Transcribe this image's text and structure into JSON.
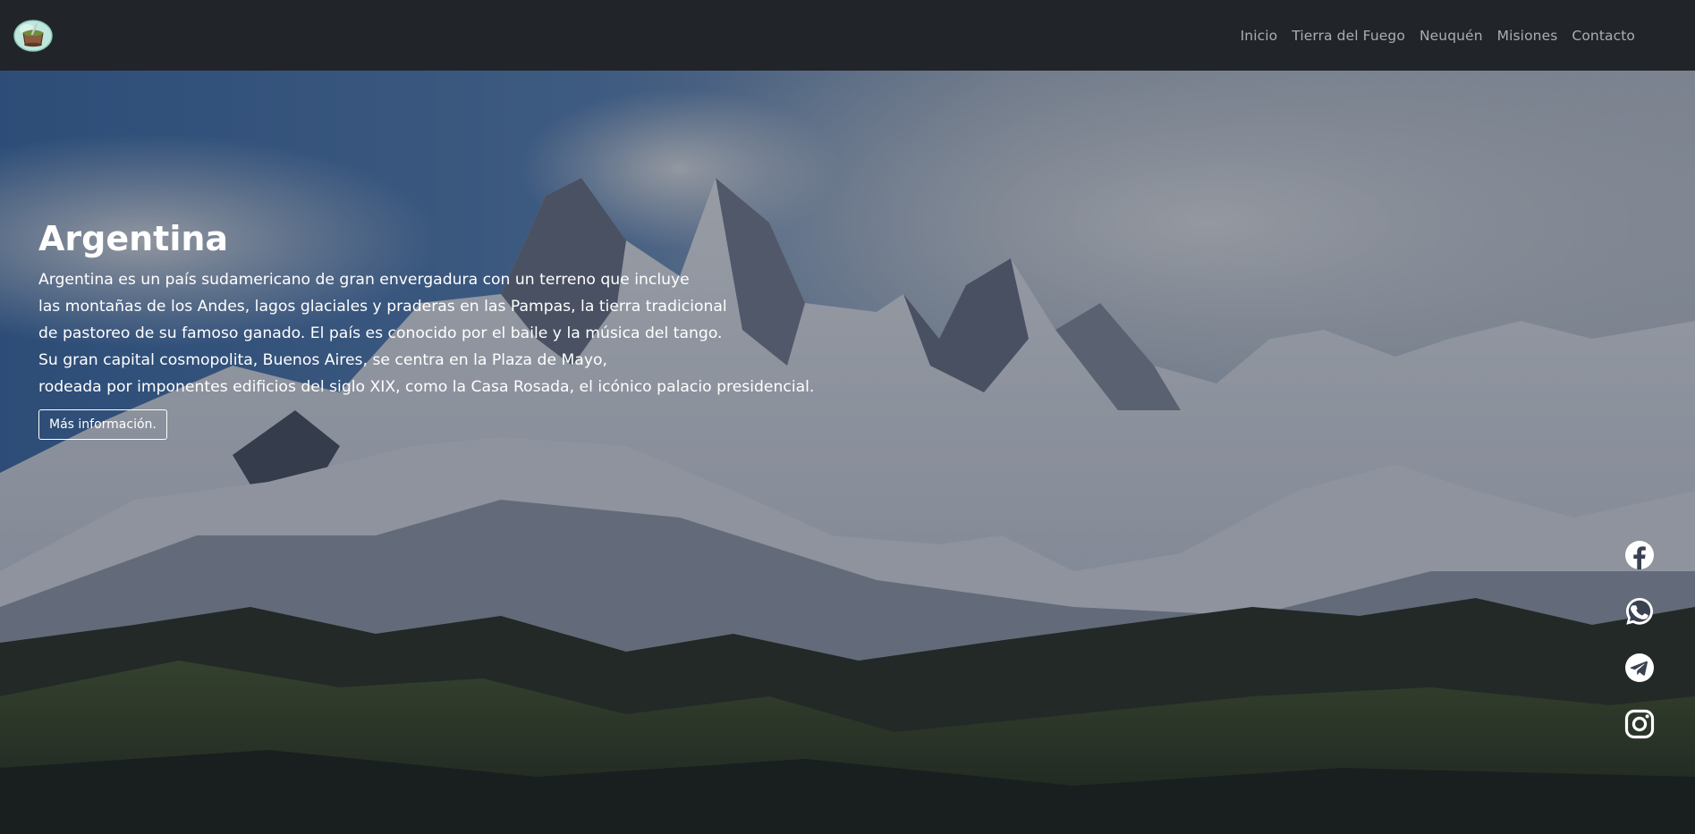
{
  "navbar": {
    "logo_icon": "mate-cup-logo-icon",
    "links": [
      {
        "label": "Inicio"
      },
      {
        "label": "Tierra del Fuego"
      },
      {
        "label": "Neuquén"
      },
      {
        "label": "Misiones"
      },
      {
        "label": "Contacto"
      }
    ]
  },
  "hero": {
    "background": "snowy-andes-mountains-photo",
    "title": "Argentina",
    "lines": [
      "Argentina es un país sudamericano de gran envergadura con un terreno que incluye",
      "las montañas de los Andes, lagos glaciales y praderas en las Pampas, la tierra tradicional",
      "de pastoreo de su famoso ganado. El país es conocido por el baile y la música del tango.",
      "Su gran capital cosmopolita, Buenos Aires, se centra en la Plaza de Mayo,",
      "rodeada por imponentes edificios del siglo XIX, como la Casa Rosada, el icónico palacio presidencial."
    ],
    "button_label": "Más información."
  },
  "social": {
    "icons": [
      "facebook-icon",
      "whatsapp-icon",
      "telegram-icon",
      "instagram-icon"
    ]
  },
  "colors": {
    "navbar_bg": "#212529",
    "nav_link": "rgba(255,255,255,0.62)",
    "text": "#ffffff"
  }
}
